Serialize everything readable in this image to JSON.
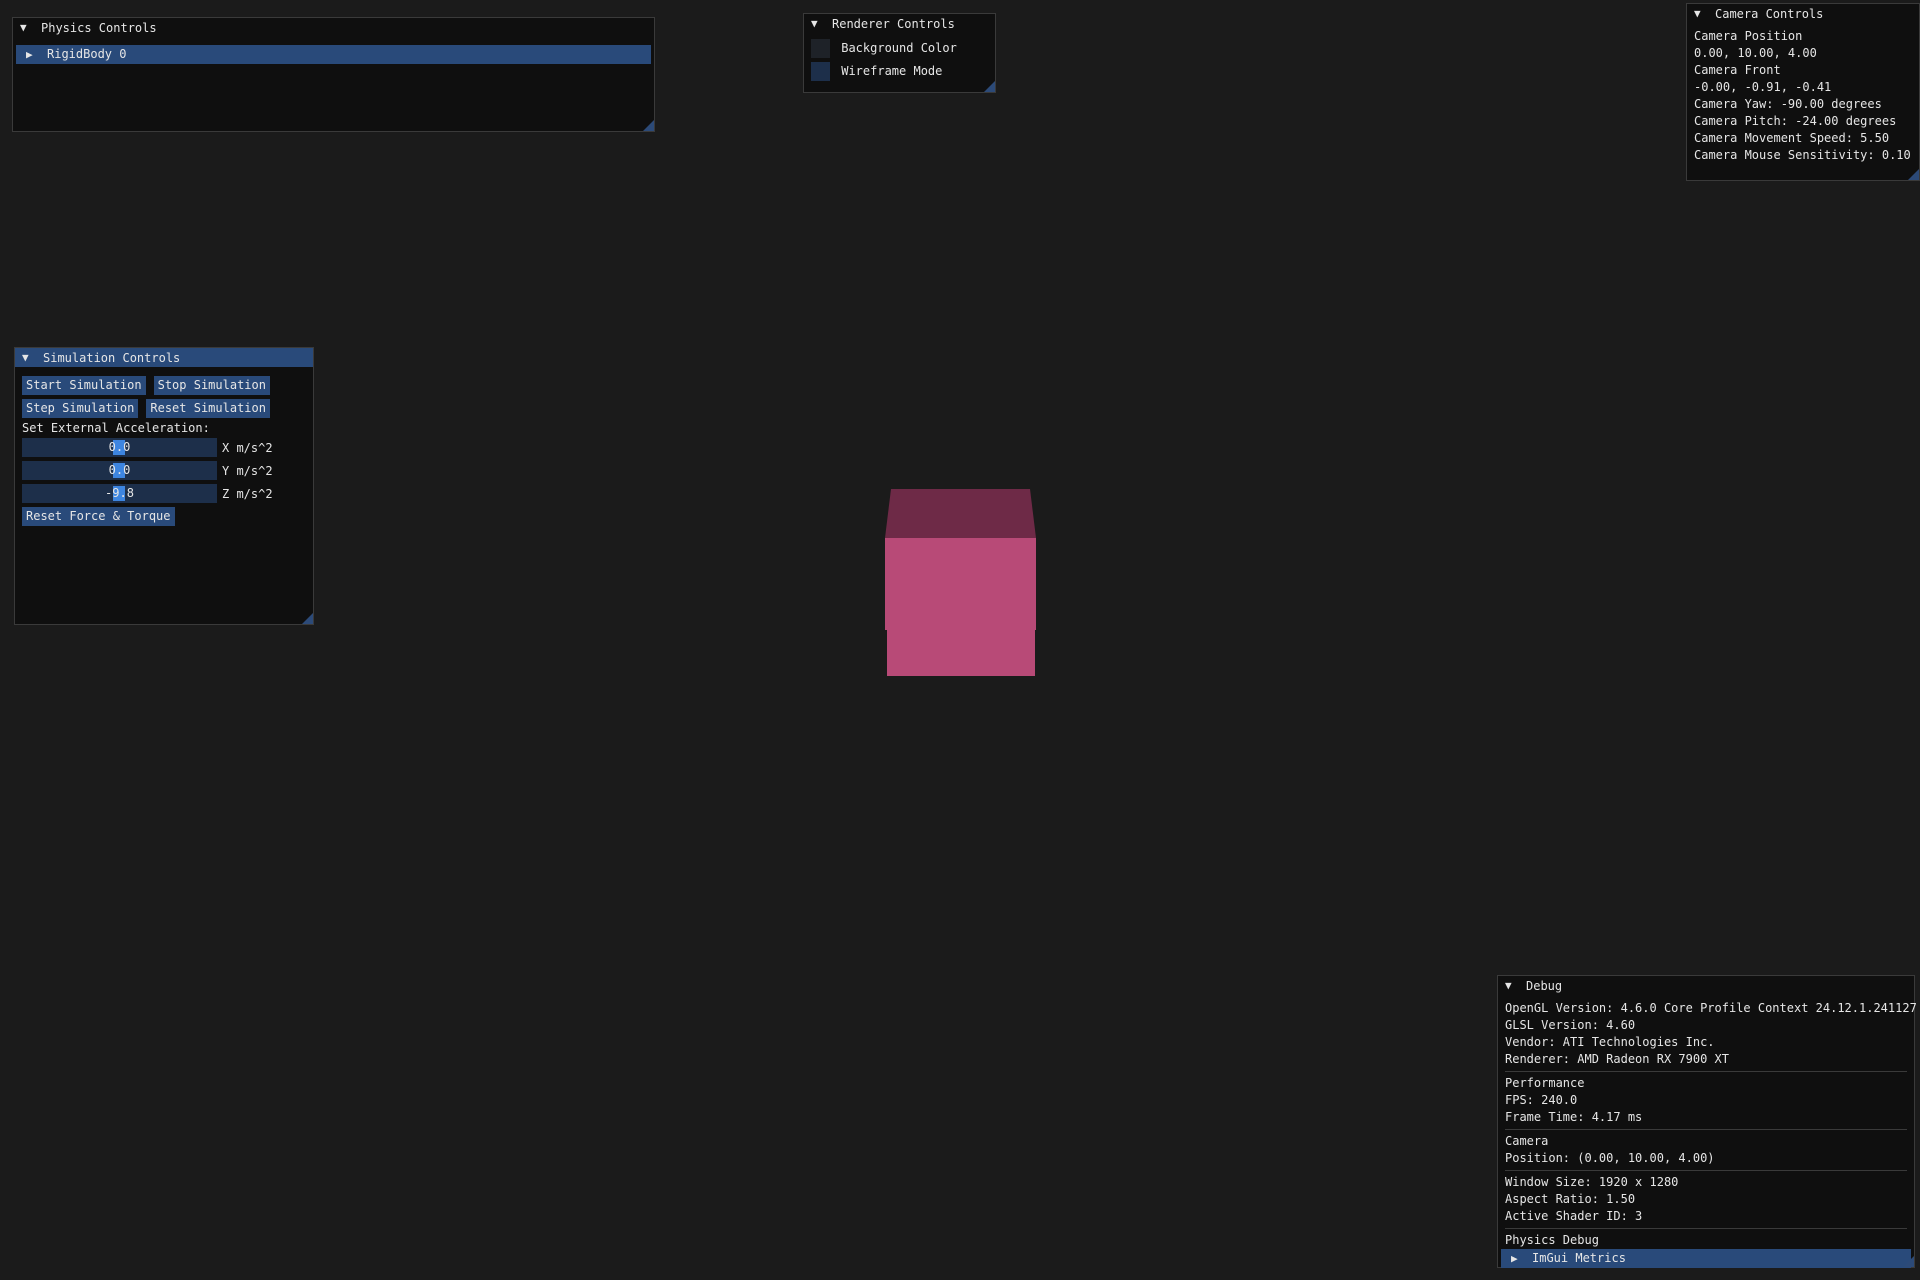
{
  "physics_panel": {
    "title": "Physics Controls",
    "items": [
      {
        "label": "RigidBody 0"
      }
    ]
  },
  "renderer_panel": {
    "title": "Renderer Controls",
    "background_color_label": "Background Color",
    "wireframe_label": "Wireframe Mode"
  },
  "camera_panel": {
    "title": "Camera Controls",
    "lines": [
      "Camera Position",
      "0.00, 10.00, 4.00",
      "Camera Front",
      "-0.00, -0.91, -0.41",
      "Camera Yaw: -90.00 degrees",
      "Camera Pitch: -24.00 degrees",
      "Camera Movement Speed: 5.50",
      "Camera Mouse Sensitivity: 0.10"
    ]
  },
  "simulation_panel": {
    "title": "Simulation Controls",
    "start_label": "Start Simulation",
    "stop_label": "Stop Simulation",
    "step_label": "Step Simulation",
    "reset_label": "Reset Simulation",
    "accel_heading": "Set External Acceleration:",
    "sliders": [
      {
        "value": "0.0",
        "label": "X m/s^2"
      },
      {
        "value": "0.0",
        "label": "Y m/s^2"
      },
      {
        "value": "-9.8",
        "label": "Z m/s^2"
      }
    ],
    "reset_force_label": "Reset Force & Torque"
  },
  "debug_panel": {
    "title": "Debug",
    "opengl": "OpenGL Version: 4.6.0 Core Profile Context 24.12.1.241127",
    "glsl": "GLSL Version: 4.60",
    "vendor": "Vendor: ATI Technologies Inc.",
    "renderer": "Renderer: AMD Radeon RX 7900 XT",
    "performance_heading": "Performance",
    "fps": "FPS: 240.0",
    "frame_time": "Frame Time: 4.17 ms",
    "camera_heading": "Camera",
    "camera_position": "Position: (0.00, 10.00, 4.00)",
    "window_size": "Window Size: 1920 x 1280",
    "aspect_ratio": "Aspect Ratio: 1.50",
    "shader_id": "Active Shader ID: 3",
    "physics_heading": "Physics Debug",
    "metrics_label": "ImGui Metrics"
  },
  "colors": {
    "background": "#1b1b1b",
    "accent": "#294a7a",
    "cube_front": "#b84a77",
    "cube_top": "#6e2a47"
  }
}
